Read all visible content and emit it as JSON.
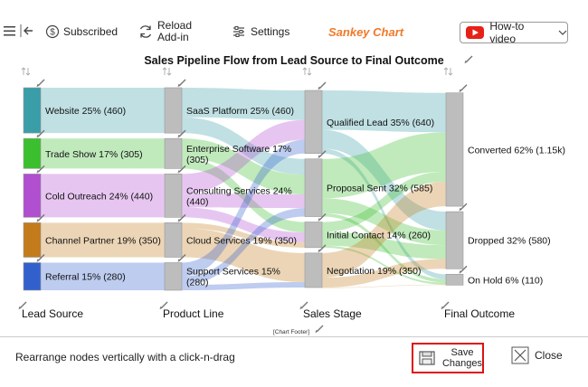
{
  "toolbar": {
    "subscribed_label": "Subscribed",
    "reload_label_line1": "Reload",
    "reload_label_line2": "Add-in",
    "settings_label": "Settings",
    "app_title": "Sankey Chart",
    "howto_label": "How-to video"
  },
  "colors": {
    "accent_title": "#f07a2a",
    "youtube_red": "#e62117",
    "save_border": "#dd1111",
    "node_gray": "#bdbdbd"
  },
  "footer": {
    "hint": "Rearrange nodes vertically with a click-n-drag",
    "save_line1": "Save",
    "save_line2": "Changes",
    "close_label": "Close"
  },
  "chart_data": {
    "type": "sankey",
    "title": "Sales Pipeline Flow from Lead Source to Final Outcome",
    "footer_label": "[Chart Footer]",
    "stages": [
      "Lead Source",
      "Product Line",
      "Sales Stage",
      "Final Outcome"
    ],
    "nodes": [
      {
        "id": "web",
        "stage": 0,
        "label": "Website 25% (460)",
        "value": 460,
        "color": "#3a9ea9"
      },
      {
        "id": "trade",
        "stage": 0,
        "label": "Trade Show 17% (305)",
        "value": 305,
        "color": "#3cbf2e"
      },
      {
        "id": "cold",
        "stage": 0,
        "label": "Cold Outreach 24% (440)",
        "value": 440,
        "color": "#b04fd0"
      },
      {
        "id": "partner",
        "stage": 0,
        "label": "Channel Partner 19% (350)",
        "value": 350,
        "color": "#c37b1b"
      },
      {
        "id": "ref",
        "stage": 0,
        "label": "Referral 15% (280)",
        "value": 280,
        "color": "#3160cc"
      },
      {
        "id": "saas",
        "stage": 1,
        "label": "SaaS Platform 25% (460)",
        "value": 460,
        "color": "#bdbdbd"
      },
      {
        "id": "ent",
        "stage": 1,
        "label": "Enterprise Software 17% (305)",
        "value": 305,
        "color": "#bdbdbd"
      },
      {
        "id": "cons",
        "stage": 1,
        "label": "Consulting Services 24% (440)",
        "value": 440,
        "color": "#bdbdbd"
      },
      {
        "id": "cloud",
        "stage": 1,
        "label": "Cloud Services 19% (350)",
        "value": 350,
        "color": "#bdbdbd"
      },
      {
        "id": "supp",
        "stage": 1,
        "label": "Support Services 15% (280)",
        "value": 280,
        "color": "#bdbdbd"
      },
      {
        "id": "qual",
        "stage": 2,
        "label": "Qualified Lead 35% (640)",
        "value": 640,
        "color": "#bdbdbd"
      },
      {
        "id": "prop",
        "stage": 2,
        "label": "Proposal Sent 32% (585)",
        "value": 585,
        "color": "#bdbdbd"
      },
      {
        "id": "init",
        "stage": 2,
        "label": "Initial Contact 14% (260)",
        "value": 260,
        "color": "#bdbdbd"
      },
      {
        "id": "nego",
        "stage": 2,
        "label": "Negotiation 19% (350)",
        "value": 350,
        "color": "#bdbdbd"
      },
      {
        "id": "conv",
        "stage": 3,
        "label": "Converted 62% (1.15k)",
        "value": 1150,
        "color": "#bdbdbd"
      },
      {
        "id": "drop",
        "stage": 3,
        "label": "Dropped 32% (580)",
        "value": 580,
        "color": "#bdbdbd"
      },
      {
        "id": "hold",
        "stage": 3,
        "label": "On Hold 6% (110)",
        "value": 110,
        "color": "#bdbdbd"
      }
    ],
    "links": [
      {
        "source": "web",
        "target": "saas",
        "value": 460
      },
      {
        "source": "trade",
        "target": "ent",
        "value": 305
      },
      {
        "source": "cold",
        "target": "cons",
        "value": 440
      },
      {
        "source": "partner",
        "target": "cloud",
        "value": 350
      },
      {
        "source": "ref",
        "target": "supp",
        "value": 280
      },
      {
        "source": "saas",
        "target": "qual",
        "value": 300
      },
      {
        "source": "saas",
        "target": "prop",
        "value": 160
      },
      {
        "source": "ent",
        "target": "prop",
        "value": 200
      },
      {
        "source": "ent",
        "target": "init",
        "value": 105
      },
      {
        "source": "cons",
        "target": "qual",
        "value": 200
      },
      {
        "source": "cons",
        "target": "prop",
        "value": 140
      },
      {
        "source": "cons",
        "target": "init",
        "value": 100
      },
      {
        "source": "cloud",
        "target": "init",
        "value": 55
      },
      {
        "source": "cloud",
        "target": "nego",
        "value": 295
      },
      {
        "source": "supp",
        "target": "qual",
        "value": 140
      },
      {
        "source": "supp",
        "target": "prop",
        "value": 85
      },
      {
        "source": "supp",
        "target": "nego",
        "value": 55
      },
      {
        "source": "qual",
        "target": "conv",
        "value": 400
      },
      {
        "source": "qual",
        "target": "drop",
        "value": 190
      },
      {
        "source": "qual",
        "target": "hold",
        "value": 50
      },
      {
        "source": "prop",
        "target": "conv",
        "value": 400
      },
      {
        "source": "prop",
        "target": "drop",
        "value": 150
      },
      {
        "source": "prop",
        "target": "hold",
        "value": 35
      },
      {
        "source": "init",
        "target": "conv",
        "value": 100
      },
      {
        "source": "init",
        "target": "drop",
        "value": 140
      },
      {
        "source": "init",
        "target": "hold",
        "value": 20
      },
      {
        "source": "nego",
        "target": "conv",
        "value": 250
      },
      {
        "source": "nego",
        "target": "drop",
        "value": 100
      },
      {
        "source": "nego",
        "target": "hold",
        "value": 5
      }
    ]
  }
}
